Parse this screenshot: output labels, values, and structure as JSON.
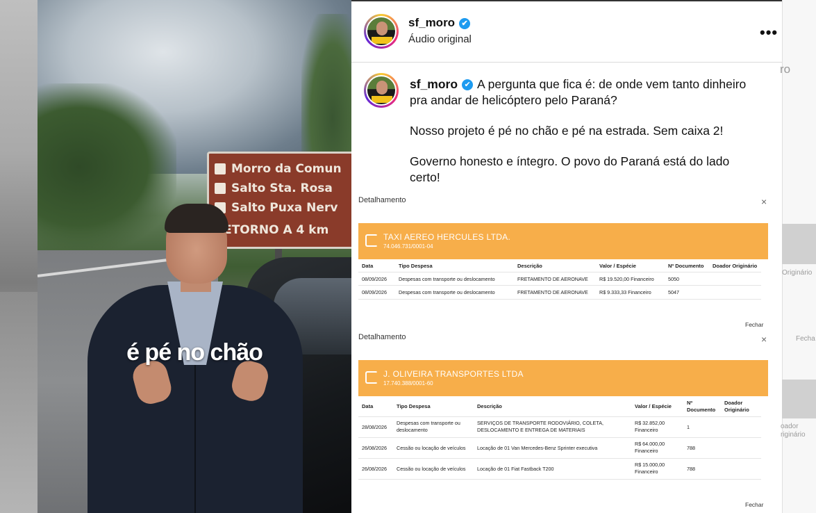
{
  "video": {
    "caption": "é pé no chão",
    "sign_lines": [
      "Morro da Comun",
      "Salto Sta. Rosa",
      "Salto Puxa Nerv",
      "RETORNO A 4 km"
    ]
  },
  "post": {
    "username": "sf_moro",
    "verified_icon": "✔",
    "audio": "Áudio original",
    "more": "•••",
    "caption_first": "A pergunta que fica é: de onde vem tanto dinheiro pra andar de helicóptero pelo Paraná?",
    "caption_p2": "Nosso projeto é pé no chão e pé na estrada. Sem caixa 2!",
    "caption_p3": "Governo honesto e íntegro. O povo do Paraná está do lado certo!"
  },
  "ghost": {
    "ro": "ro",
    "originario": "Originário",
    "fechar": "Fecha",
    "doador": "oador",
    "riginario": "riginário"
  },
  "colors": {
    "banner": "#f7ae4a",
    "verified": "#1d9bf0"
  },
  "details": [
    {
      "title": "Detalhamento",
      "close": "×",
      "company": "TAXI AEREO HERCULES LTDA.",
      "cnpj": "74.046.731/0001-04",
      "headers": [
        "Data",
        "Tipo Despesa",
        "Descrição",
        "Valor / Espécie",
        "Nº Documento",
        "Doador Originário"
      ],
      "rows": [
        [
          "08/09/2026",
          "Despesas com transporte ou deslocamento",
          "FRETAMENTO DE AERONAVE",
          "R$ 19.520,00 Financeiro",
          "5050",
          ""
        ],
        [
          "08/09/2026",
          "Despesas com transporte ou deslocamento",
          "FRETAMENTO DE AERONAVE",
          "R$ 9.333,33 Financeiro",
          "5047",
          ""
        ]
      ],
      "fechar": "Fechar"
    },
    {
      "title": "Detalhamento",
      "close": "×",
      "company": "J. OLIVEIRA TRANSPORTES LTDA",
      "cnpj": "17.740.388/0001-60",
      "headers": [
        "Data",
        "Tipo Despesa",
        "Descrição",
        "Valor / Espécie",
        "Nº Documento",
        "Doador Originário"
      ],
      "rows": [
        [
          "28/08/2026",
          "Despesas com transporte ou deslocamento",
          "SERVIÇOS DE TRANSPORTE RODOVIÁRIO, COLETA, DESLOCAMENTO E ENTREGA DE MATERIAIS",
          "R$ 32.852,00 Financeiro",
          "1",
          ""
        ],
        [
          "26/08/2026",
          "Cessão ou locação de veículos",
          "Locação de 01 Van Mercedes-Benz Sprinter executiva",
          "R$ 64.000,00 Financeiro",
          "788",
          ""
        ],
        [
          "26/08/2026",
          "Cessão ou locação de veículos",
          "Locação de 01 Fiat Fastback T200",
          "R$ 15.000,00 Financeiro",
          "788",
          ""
        ]
      ],
      "fechar": "Fechar"
    }
  ]
}
